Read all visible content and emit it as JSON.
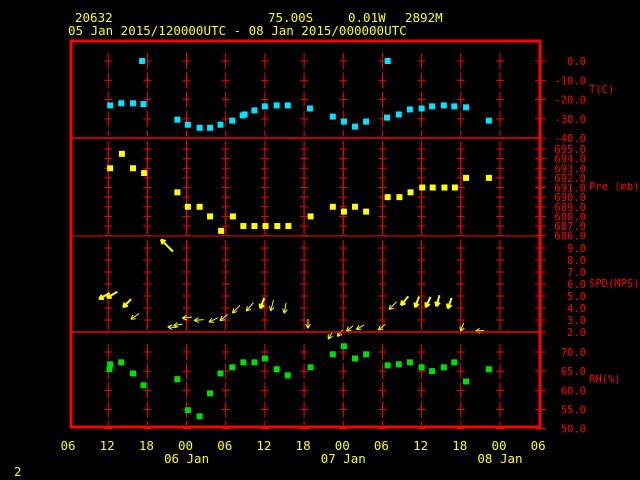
{
  "header": {
    "station": "20632",
    "lat": "75.00S",
    "lon": "0.01W",
    "elev": "2892M",
    "period": "05 Jan 2015/120000UTC - 08 Jan 2015/000000UTC"
  },
  "footer": {
    "page": "2"
  },
  "colors": {
    "frame": "#ff0000",
    "text": "#ffff00",
    "temp": "#00e5ff",
    "pres": "#ffff00",
    "wind": "#ffff00",
    "rh": "#00e000"
  },
  "chart_data": {
    "type": "scatter",
    "x_axis": {
      "unit": "hours since 05 Jan 2015 06UTC",
      "range": [
        0,
        72
      ],
      "tick_labels": [
        "06",
        "12",
        "18",
        "00",
        "06",
        "12",
        "18",
        "00",
        "06",
        "12",
        "18",
        "00",
        "06"
      ],
      "date_labels": [
        {
          "hour": 18,
          "label": "06 Jan"
        },
        {
          "hour": 42,
          "label": "07 Jan"
        },
        {
          "hour": 66,
          "label": "08 Jan"
        }
      ]
    },
    "panels": [
      {
        "name": "temperature",
        "label": "T(C)",
        "range": [
          -40,
          0
        ],
        "ticks": [
          "0.0",
          "-10.0",
          "-20.0",
          "-30.0",
          "-40.0"
        ],
        "tick_values": [
          0,
          -10,
          -20,
          -30,
          -40
        ],
        "type": "scatter",
        "points": [
          [
            6.3,
            -23
          ],
          [
            8.0,
            -21.9
          ],
          [
            9.8,
            -21.9
          ],
          [
            11.4,
            -22.3
          ],
          [
            11.2,
            0.0
          ],
          [
            16.6,
            -30.4
          ],
          [
            18.2,
            -33
          ],
          [
            20.0,
            -34.6
          ],
          [
            21.6,
            -34.6
          ],
          [
            23.2,
            -33
          ],
          [
            25.0,
            -30.9
          ],
          [
            26.6,
            -28.2
          ],
          [
            26.9,
            -27.7
          ],
          [
            28.4,
            -25.6
          ],
          [
            30.0,
            -23.5
          ],
          [
            31.8,
            -23
          ],
          [
            33.5,
            -23
          ],
          [
            36.9,
            -24.6
          ],
          [
            40.4,
            -28.8
          ],
          [
            42.1,
            -31.4
          ],
          [
            43.8,
            -34
          ],
          [
            45.5,
            -31.4
          ],
          [
            48.8,
            0.0
          ],
          [
            48.7,
            -29.3
          ],
          [
            50.5,
            -27.7
          ],
          [
            52.2,
            -25.1
          ],
          [
            54.0,
            -24.6
          ],
          [
            55.6,
            -23.5
          ],
          [
            57.4,
            -23
          ],
          [
            59.0,
            -23.5
          ],
          [
            60.8,
            -24
          ],
          [
            64.3,
            -30.9
          ]
        ]
      },
      {
        "name": "pressure",
        "label": "Pre (mb)",
        "range": [
          686,
          695
        ],
        "ticks": [
          "695.0",
          "694.0",
          "693.0",
          "692.0",
          "691.0",
          "690.0",
          "689.0",
          "688.0",
          "687.0",
          "686.0"
        ],
        "tick_values": [
          695,
          694,
          693,
          692,
          691,
          690,
          689,
          688,
          687,
          686
        ],
        "type": "scatter",
        "points": [
          [
            6.3,
            693
          ],
          [
            8.1,
            694.5
          ],
          [
            9.8,
            693
          ],
          [
            11.5,
            692.5
          ],
          [
            16.6,
            690.5
          ],
          [
            18.2,
            689
          ],
          [
            20.0,
            689
          ],
          [
            21.6,
            688
          ],
          [
            23.3,
            686.5
          ],
          [
            25.1,
            688
          ],
          [
            26.7,
            687
          ],
          [
            28.4,
            687
          ],
          [
            30.1,
            687
          ],
          [
            31.9,
            687
          ],
          [
            33.6,
            687
          ],
          [
            37.0,
            688
          ],
          [
            40.4,
            689
          ],
          [
            42.1,
            688.5
          ],
          [
            43.8,
            689
          ],
          [
            45.5,
            688.5
          ],
          [
            48.8,
            690
          ],
          [
            50.6,
            690
          ],
          [
            52.3,
            690.5
          ],
          [
            54.1,
            691
          ],
          [
            55.7,
            691
          ],
          [
            57.5,
            691
          ],
          [
            59.1,
            691
          ],
          [
            60.8,
            692
          ],
          [
            64.3,
            692
          ]
        ]
      },
      {
        "name": "wind",
        "label": "SPD(MPS)",
        "range": [
          2,
          9
        ],
        "ticks": [
          "9.0",
          "8.0",
          "7.0",
          "6.0",
          "5.0",
          "4.0",
          "3.0",
          "2.0"
        ],
        "tick_values": [
          9,
          8,
          7,
          6,
          5,
          4,
          3,
          2
        ],
        "type": "vector",
        "points_hour_speed_dirdeg": [
          [
            5.4,
            5.0,
            60
          ],
          [
            6.6,
            5.1,
            60
          ],
          [
            8.9,
            4.4,
            45
          ],
          [
            10.1,
            3.3,
            55
          ],
          [
            15.0,
            9.2,
            135
          ],
          [
            15.8,
            2.4,
            95
          ],
          [
            16.7,
            2.6,
            80
          ],
          [
            18.1,
            3.2,
            85
          ],
          [
            19.9,
            3.0,
            85
          ],
          [
            22.1,
            3.0,
            65
          ],
          [
            23.7,
            3.2,
            50
          ],
          [
            25.6,
            3.9,
            45
          ],
          [
            27.7,
            4.1,
            40
          ],
          [
            29.6,
            4.4,
            20
          ],
          [
            31.1,
            4.2,
            15
          ],
          [
            33.1,
            4.0,
            10
          ],
          [
            36.6,
            2.7,
            0
          ],
          [
            40.0,
            1.7,
            30
          ],
          [
            41.5,
            1.9,
            40
          ],
          [
            43.0,
            2.3,
            50
          ],
          [
            44.6,
            2.4,
            60
          ],
          [
            47.9,
            2.4,
            50
          ],
          [
            49.6,
            4.2,
            45
          ],
          [
            51.4,
            4.6,
            40
          ],
          [
            53.3,
            4.5,
            20
          ],
          [
            55.0,
            4.5,
            25
          ],
          [
            56.5,
            4.6,
            15
          ],
          [
            58.3,
            4.4,
            20
          ],
          [
            60.2,
            2.4,
            20
          ],
          [
            62.9,
            2.1,
            85
          ]
        ]
      },
      {
        "name": "rh",
        "label": "RH(%)",
        "range": [
          50,
          70
        ],
        "ticks": [
          "70.0",
          "65.0",
          "60.0",
          "55.0",
          "50.0"
        ],
        "tick_values": [
          70,
          65,
          60,
          55,
          50
        ],
        "type": "scatter",
        "points": [
          [
            6.3,
            66.8
          ],
          [
            6.2,
            65.5
          ],
          [
            8.0,
            67.3
          ],
          [
            9.8,
            64.4
          ],
          [
            11.4,
            61.3
          ],
          [
            16.6,
            62.9
          ],
          [
            18.2,
            54.8
          ],
          [
            20.0,
            53.2
          ],
          [
            21.6,
            59.2
          ],
          [
            23.2,
            64.4
          ],
          [
            25.0,
            66
          ],
          [
            26.7,
            67.3
          ],
          [
            28.4,
            67.3
          ],
          [
            30.0,
            68.3
          ],
          [
            31.8,
            65.5
          ],
          [
            33.5,
            63.9
          ],
          [
            37.0,
            66
          ],
          [
            40.4,
            69.4
          ],
          [
            42.1,
            71.5
          ],
          [
            43.8,
            68.3
          ],
          [
            45.5,
            69.4
          ],
          [
            48.8,
            66.5
          ],
          [
            50.5,
            66.8
          ],
          [
            52.2,
            67.3
          ],
          [
            54.0,
            66
          ],
          [
            55.6,
            65
          ],
          [
            57.4,
            66
          ],
          [
            59.0,
            67.3
          ],
          [
            60.8,
            62.3
          ],
          [
            64.3,
            65.5
          ]
        ]
      }
    ]
  }
}
